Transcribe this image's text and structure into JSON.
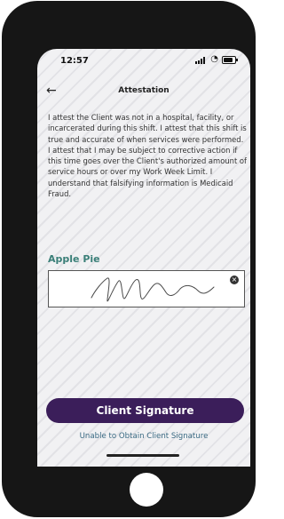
{
  "status_bar": {
    "time": "12:57",
    "icons": [
      "signal-icon",
      "wifi-icon",
      "battery-icon"
    ]
  },
  "header": {
    "title": "Attestation",
    "back_icon": "arrow-left-icon"
  },
  "attestation": {
    "text": "I attest the Client was not in a hospital, facility, or incarcerated during this shift. I attest that this shift is true and accurate of when services were performed. I attest that I may be subject to corrective action if this time goes over the Client's authorized amount of service hours or over my Work Week Limit. I understand that falsifying information is Medicaid Fraud."
  },
  "client": {
    "name": "Apple Pie"
  },
  "signature": {
    "clear_icon": "close-circle-icon"
  },
  "actions": {
    "primary_label": "Client Signature",
    "link_label": "Unable to Obtain Client Signature"
  },
  "colors": {
    "primary": "#3b1e5a",
    "accent_teal": "#3a7f78",
    "link": "#3a6a83"
  }
}
